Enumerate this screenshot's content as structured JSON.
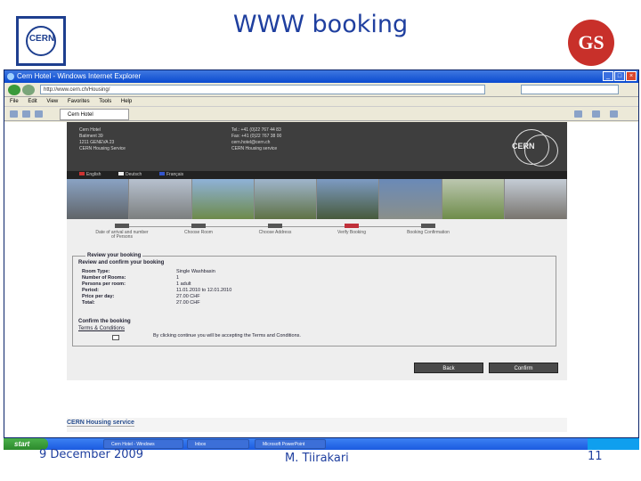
{
  "slide": {
    "title": "WWW booking",
    "date": "9 December 2009",
    "author": "M. Tiirakari",
    "page_number": "11",
    "logos": {
      "left": "CERN",
      "right": "GS"
    }
  },
  "browser": {
    "window_title": "Cern Hotel - Windows Internet Explorer",
    "address": "http://www.cern.ch/Housing/",
    "menu": [
      "File",
      "Edit",
      "View",
      "Favorites",
      "Tools",
      "Help"
    ],
    "tab_label": "Cern Hotel"
  },
  "site": {
    "hotel_name": "Cern Hotel",
    "address_line1": "Batiment 39",
    "address_line2": "1211 GENEVA 23",
    "address_line3": "CERN Housing Service",
    "contact_line1": "Tel.: +41 (0)22 767 44 83",
    "contact_line2": "Fax: +41 (0)22 767 38 00",
    "contact_line3": "cern.hotel@cern.ch",
    "contact_line4": "CERN Housing service",
    "logo_text": "CERN",
    "languages": [
      "English",
      "Deutsch",
      "Français"
    ],
    "steps": [
      {
        "label": "Date of arrival and number of Persons"
      },
      {
        "label": "Choose Room"
      },
      {
        "label": "Choose Address"
      },
      {
        "label": "Verify Booking"
      },
      {
        "label": "Booking Confirmation"
      }
    ],
    "current_step_index": 3,
    "review_title": "Review your booking",
    "review_subtitle": "Review and confirm your booking",
    "fields": [
      {
        "key": "Room Type:",
        "value": "Single Washbasin"
      },
      {
        "key": "Number of Rooms:",
        "value": "1"
      },
      {
        "key": "Persons per room:",
        "value": "1 adult"
      },
      {
        "key": "Period:",
        "value": "11.01.2010 to 12.01.2010"
      },
      {
        "key": "Price per day:",
        "value": "27.00 CHF"
      },
      {
        "key": "Total:",
        "value": "27.00 CHF"
      }
    ],
    "confirm_title": "Confirm the booking",
    "terms_title": "Terms & Conditions",
    "terms_text": "By clicking continue you will be accepting the Terms and Conditions.",
    "back_button": "Back",
    "confirm_button": "Confirm",
    "footer": "CERN Housing service"
  },
  "taskbar": {
    "start": "start",
    "tasks": [
      "Cern Hotel - Windows",
      "Inbox",
      "Microsoft PowerPoint"
    ]
  },
  "colors": {
    "slide_text": "#1f3f9f",
    "current_step": "#c0303a",
    "site_header": "#3e3e3e"
  }
}
